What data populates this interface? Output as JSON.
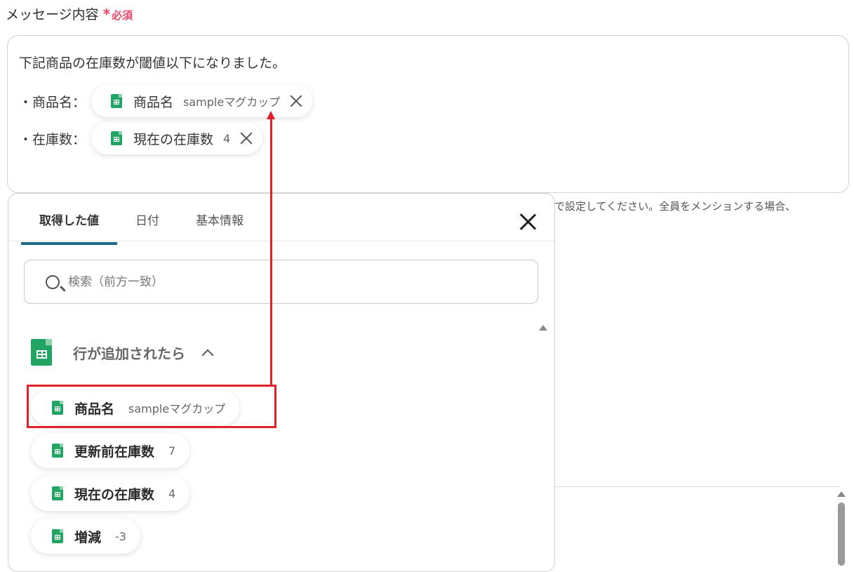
{
  "field": {
    "title": "メッセージ内容",
    "required_mark": "*",
    "required_label": "必須"
  },
  "message": {
    "line1": "下記商品の在庫数が閾値以下になりました。",
    "rows": [
      {
        "label": "・商品名：",
        "chip_name": "商品名",
        "chip_value": "sampleマグカップ"
      },
      {
        "label": "・在庫数：",
        "chip_name": "現在の在庫数",
        "chip_value": "4"
      }
    ]
  },
  "hint": "で設定してください。全員をメンションする場合、",
  "panel": {
    "tabs": [
      "取得した値",
      "日付",
      "基本情報"
    ],
    "active_tab": "取得した値",
    "search_placeholder": "検索（前方一致）",
    "group_title": "行が追加されたら",
    "items": [
      {
        "name": "商品名",
        "value": "sampleマグカップ"
      },
      {
        "name": "更新前在庫数",
        "value": "7"
      },
      {
        "name": "現在の在庫数",
        "value": "4"
      },
      {
        "name": "増減",
        "value": "-3"
      }
    ]
  },
  "colors": {
    "accent": "#1a6b8c",
    "required": "#e5466b",
    "annotation": "#e0202a",
    "sheets_green": "#21a464"
  },
  "icons": [
    "google-sheets-icon",
    "close-icon",
    "search-icon",
    "chevron-up-icon"
  ]
}
